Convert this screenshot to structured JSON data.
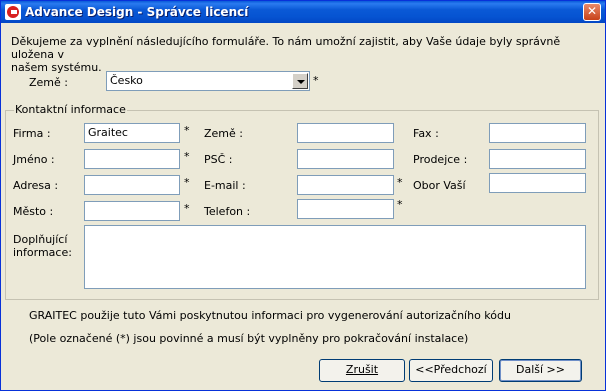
{
  "window": {
    "title": "Advance Design - Správce licencí",
    "close_glyph": "✕"
  },
  "intro": "Děkujeme za vyplnění následujícího formuláře. To nám umožní zajistit, aby Vaše údaje byly správně uložena v\nnašem systému.",
  "country": {
    "label": "Země :",
    "value": "Česko"
  },
  "contact": {
    "title": "Kontaktní informace",
    "firma_label": "Firma :",
    "firma_value": "Graitec",
    "jmeno_label": "Jméno :",
    "adresa_label": "Adresa :",
    "mesto_label": "Město :",
    "zeme_label": "Země :",
    "psc_label": "PSČ :",
    "email_label": "E-mail :",
    "telefon_label": "Telefon :",
    "fax_label": "Fax :",
    "prodejce_label": "Prodejce :",
    "obor_label": "Obor Vaší",
    "doplnujici_label": "Doplňující\ninformace:"
  },
  "required_mark": "*",
  "notes": {
    "graitec": "GRAITEC použije tuto Vámi poskytnutou informaci pro vygenerování autorizačního kódu",
    "required": "(Pole označené (*) jsou povinné a musí být vyplněny pro pokračování instalace)"
  },
  "buttons": {
    "cancel_label": "Zrušit",
    "back_label": "<<Předchozí",
    "next_label": "Další >>"
  }
}
